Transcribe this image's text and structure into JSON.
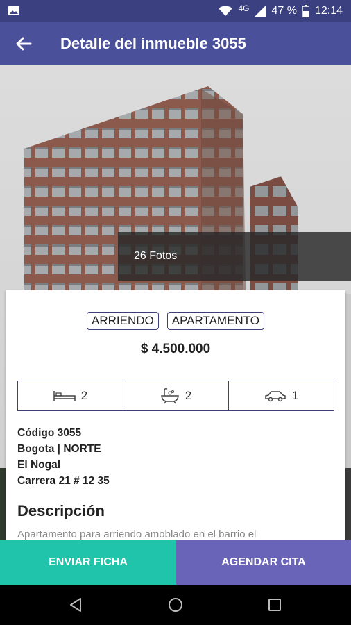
{
  "status_bar": {
    "network": "4G",
    "battery": "47 %",
    "time": "12:14",
    "icons": [
      "image-icon",
      "wifi-icon",
      "signal-icon",
      "battery-icon"
    ]
  },
  "app_bar": {
    "title": "Detalle del inmueble 3055",
    "back_icon": "arrow-left-icon"
  },
  "gallery": {
    "photo_count_label": "26 Fotos"
  },
  "listing": {
    "tags": [
      "ARRIENDO",
      "APARTAMENTO"
    ],
    "price": "$ 4.500.000",
    "features": [
      {
        "icon": "bed-icon",
        "value": "2"
      },
      {
        "icon": "bathtub-icon",
        "value": "2"
      },
      {
        "icon": "car-icon",
        "value": "1"
      }
    ],
    "code": "Código 3055",
    "location": "Bogota | NORTE",
    "neighborhood": "El Nogal",
    "address": "Carrera 21 # 12 35",
    "description_title": "Descripción",
    "description_text": "Apartamento para arriendo amoblado en el barrio el"
  },
  "actions": {
    "send_label": "ENVIAR FICHA",
    "schedule_label": "AGENDAR CITA"
  },
  "colors": {
    "status_bar": "#3b4080",
    "app_bar": "#4b509a",
    "send_button": "#20c4aa",
    "schedule_button": "#6a64b8",
    "border": "#3c3f78"
  }
}
